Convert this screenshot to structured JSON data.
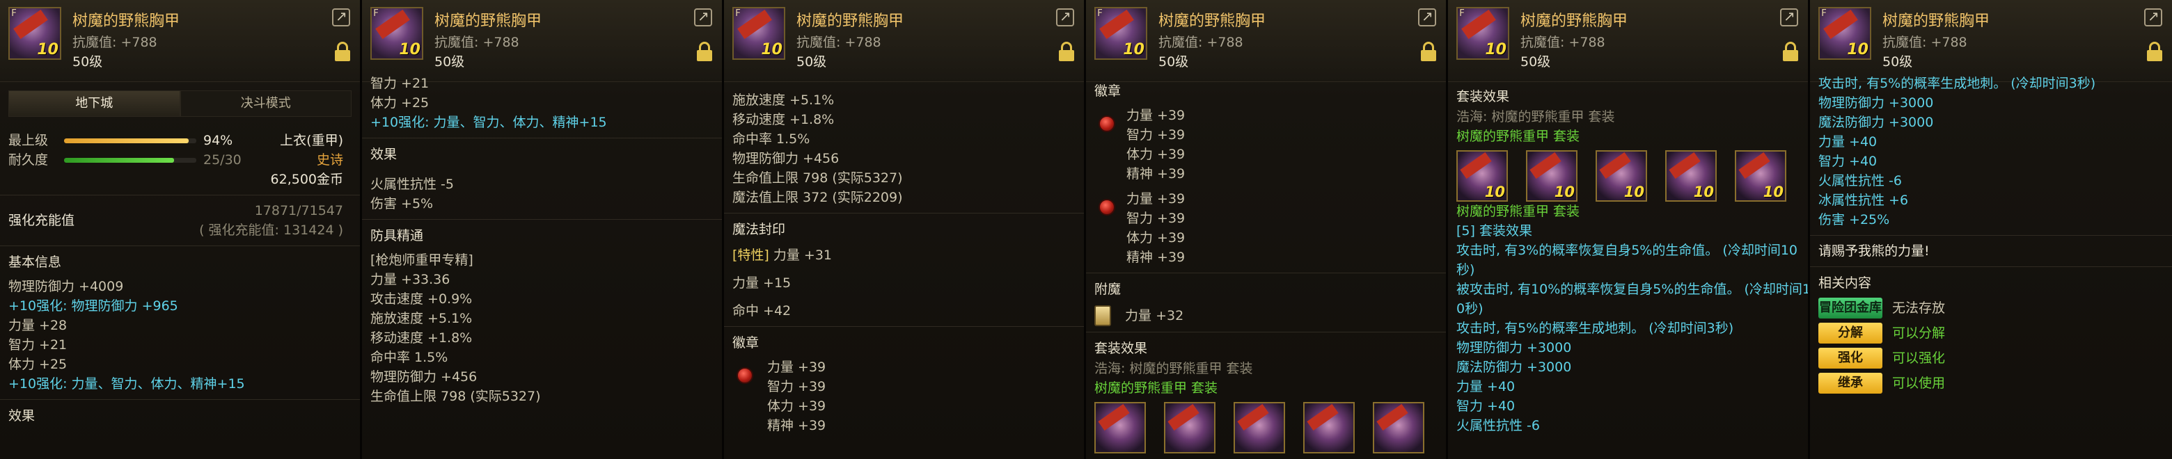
{
  "item": {
    "name": "树魔的野熊胸甲",
    "resist": "抗魔值: +788",
    "level": "50级",
    "icon_level": "10",
    "icon_grade": "F"
  },
  "colors": {
    "accent_gold": "#f0c36a",
    "cyan": "#5fd2e8",
    "green": "#69d23a",
    "orange": "#e4a33c"
  },
  "panel1": {
    "tabs": [
      "地下城",
      "决斗模式"
    ],
    "max_level_label": "最上级",
    "max_level_pct": "94%",
    "max_level_fill": 0.94,
    "durability_label": "耐久度",
    "durability_value": "25/30",
    "durability_fill": 0.833,
    "slot": "上衣(重甲)",
    "rarity": "史诗",
    "price": "62,500金币",
    "reinforce_title": "强化充能值",
    "reinforce_value": "17871/71547",
    "reinforce_note": "( 强化充能值: 131424 )",
    "basic_title": "基本信息",
    "lines": [
      {
        "text": "物理防御力 +4009",
        "color": "normal"
      },
      {
        "text": "+10强化: 物理防御力 +965",
        "color": "cyan"
      },
      {
        "text": "力量 +28",
        "color": "normal"
      },
      {
        "text": "智力 +21",
        "color": "normal"
      },
      {
        "text": "体力 +25",
        "color": "normal"
      },
      {
        "text": "+10强化: 力量、智力、体力、精神+15",
        "color": "cyan"
      }
    ],
    "effect_title": "效果"
  },
  "panel2": {
    "top_lines": [
      {
        "text": "智力 +21",
        "color": "normal"
      },
      {
        "text": "体力 +25",
        "color": "normal"
      },
      {
        "text": "+10强化: 力量、智力、体力、精神+15",
        "color": "cyan"
      }
    ],
    "effect_title": "效果",
    "effect_lines": [
      "火属性抗性 -5",
      "伤害 +5%"
    ],
    "mastery_title": "防具精通",
    "mastery_lines": [
      "[枪炮师重甲专精]",
      "力量 +33.36",
      "攻击速度 +0.9%",
      "施放速度 +5.1%",
      "移动速度 +1.8%",
      "命中率 1.5%",
      "物理防御力 +456",
      "生命值上限 798 (实际5327)"
    ]
  },
  "panel3": {
    "top_lines": [
      "施放速度 +5.1%",
      "移动速度 +1.8%",
      "命中率 1.5%",
      "物理防御力 +456",
      "生命值上限 798 (实际5327)",
      "魔法值上限 372 (实际2209)"
    ],
    "seal_title": "魔法封印",
    "seal_lines": [
      {
        "prefix": "[特性]",
        "text": "力量 +31"
      },
      {
        "prefix": "",
        "text": "力量 +15"
      },
      {
        "prefix": "",
        "text": "命中 +42"
      }
    ],
    "emblem_title": "徽章",
    "emblem_lines": [
      "力量 +39",
      "智力 +39",
      "体力 +39",
      "精神 +39"
    ]
  },
  "panel4": {
    "emblem_title": "徽章",
    "emblem_group_1": [
      "力量 +39",
      "智力 +39",
      "体力 +39",
      "精神 +39"
    ],
    "emblem_group_2": [
      "力量 +39",
      "智力 +39",
      "体力 +39",
      "精神 +39"
    ],
    "enchant_title": "附魔",
    "enchant_line": "力量 +32",
    "set_title": "套装效果",
    "set_owner": "浩海: 树魔的野熊重甲 套装",
    "set_name": "树魔的野熊重甲 套装"
  },
  "panel5": {
    "set_title": "套装效果",
    "set_owner": "浩海: 树魔的野熊重甲 套装",
    "set_name": "树魔的野熊重甲 套装",
    "set_name_2": "树魔的野熊重甲 套装",
    "set_count": "[5] 套装效果",
    "set_lines": [
      {
        "text": "攻击时, 有3%的概率恢复自身5%的生命值。 (冷却时间10",
        "color": "cyan"
      },
      {
        "text": "秒)",
        "color": "cyan"
      },
      {
        "text": "被攻击时, 有10%的概率恢复自身5%的生命值。 (冷却时间1",
        "color": "cyan"
      },
      {
        "text": "0秒)",
        "color": "cyan"
      },
      {
        "text": "攻击时, 有5%的概率生成地刺。 (冷却时间3秒)",
        "color": "cyan"
      },
      {
        "text": "物理防御力 +3000",
        "color": "cyan"
      },
      {
        "text": "魔法防御力 +3000",
        "color": "cyan"
      },
      {
        "text": "力量 +40",
        "color": "cyan"
      },
      {
        "text": "智力 +40",
        "color": "cyan"
      },
      {
        "text": "火属性抗性 -6",
        "color": "cyan"
      }
    ]
  },
  "panel6": {
    "top_line": "攻击时, 有5%的概率生成地刺。 (冷却时间3秒)",
    "lines": [
      "物理防御力 +3000",
      "魔法防御力 +3000",
      "力量 +40",
      "智力 +40",
      "火属性抗性 -6",
      "冰属性抗性 +6",
      "伤害 +25%"
    ],
    "quote": "请赐予我熊的力量!",
    "related_title": "相关内容",
    "vault_badge": "冒险团金库",
    "vault_text": "无法存放",
    "actions": [
      {
        "label": "分解",
        "status": "可以分解"
      },
      {
        "label": "强化",
        "status": "可以强化"
      },
      {
        "label": "继承",
        "status": "可以使用"
      }
    ]
  }
}
